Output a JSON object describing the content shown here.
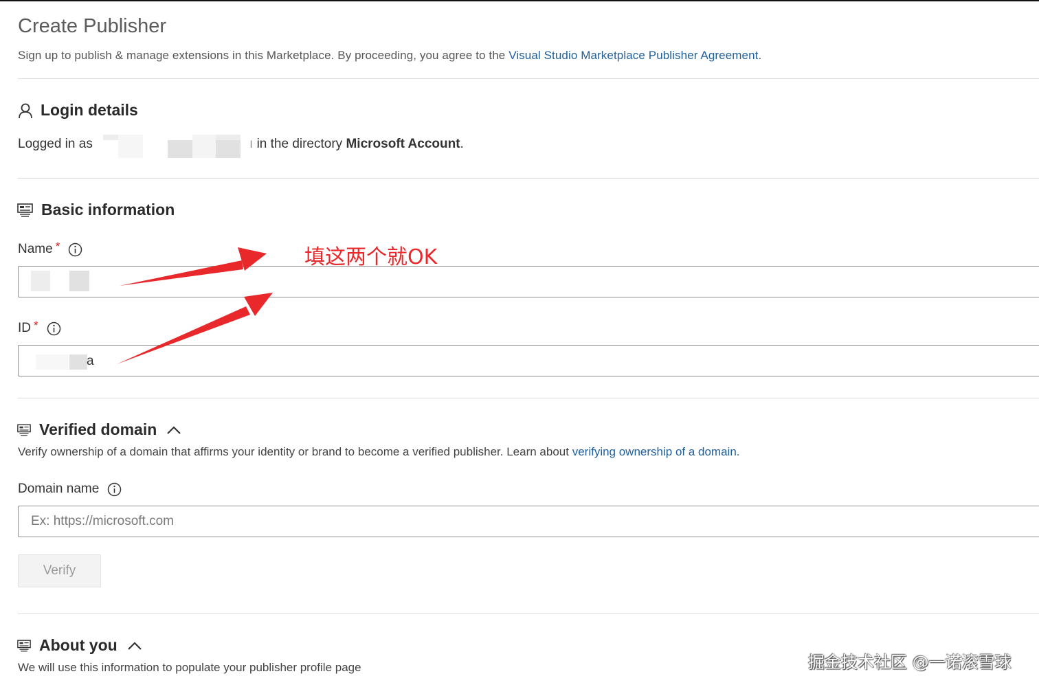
{
  "header": {
    "title": "Create Publisher",
    "intro_text": "Sign up to publish & manage extensions in this Marketplace. By proceeding, you agree to the ",
    "agreement_link": "Visual Studio Marketplace Publisher Agreement",
    "intro_end": "."
  },
  "login": {
    "title": "Login details",
    "logged_in_prefix": "Logged in as",
    "directory_text": "in the directory",
    "directory_name": "Microsoft Account",
    "end": "."
  },
  "basic": {
    "title": "Basic information",
    "name_label": "Name",
    "id_label": "ID",
    "required_mark": "*",
    "id_visible_char": "a"
  },
  "domain": {
    "title": "Verified domain",
    "description": "Verify ownership of a domain that affirms your identity or brand to become a verified publisher. Learn about ",
    "link": "verifying ownership of a domain.",
    "field_label": "Domain name",
    "placeholder": "Ex: https://microsoft.com",
    "verify_label": "Verify"
  },
  "about": {
    "title": "About you",
    "description": "We will use this information to populate your publisher profile page"
  },
  "annotation": {
    "text": "填这两个就OK",
    "color": "#e8282b"
  },
  "watermark": {
    "text": "掘金技术社区 @一诺滚雪球"
  },
  "colors": {
    "link": "#1f5f9a",
    "required": "#d32020",
    "annotation": "#e8282b"
  },
  "icons": {
    "login": "person-icon",
    "basic": "form-icon",
    "domain": "form-icon",
    "about": "form-icon",
    "info": "info-circle-icon",
    "collapse": "chevron-up-icon"
  }
}
